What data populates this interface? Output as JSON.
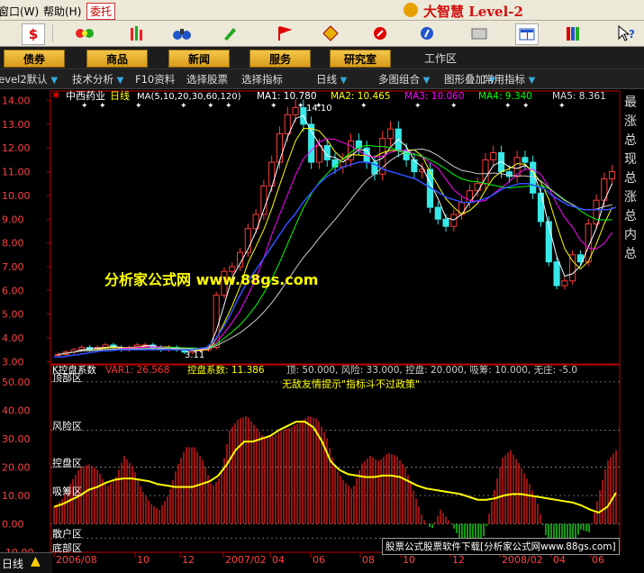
{
  "menu": {
    "window_label": "窗口(W)",
    "help_label": "帮助(H)",
    "order_label": "委托",
    "brand": "大智慧 Level-2"
  },
  "toolbar": {
    "icons": [
      "dollar-icon",
      "eye-icon",
      "bars-icon",
      "binoculars-icon",
      "flag-icon",
      "diamond-icon",
      "crystal-icon",
      "doc-icon",
      "grid-icon",
      "books-icon",
      "help-cursor-icon"
    ]
  },
  "nav": {
    "items": [
      "债券",
      "商品",
      "新闻",
      "服务",
      "研究室"
    ],
    "workspace": "工作区"
  },
  "subbar": {
    "items": [
      "Level2默认",
      "技术分析",
      "F10资料",
      "选择股票",
      "选择指标",
      "日线",
      "多图组合",
      "图形叠加",
      "常用指标"
    ]
  },
  "price_panel": {
    "stock_name": "中西药业",
    "period": "日线",
    "ma_label": "MA(5,10,20,30,60,120)",
    "ma_values": [
      {
        "label": "MA1:",
        "value": "10.780",
        "color": "#ffffff"
      },
      {
        "label": "MA2:",
        "value": "10.465",
        "color": "#ffff00"
      },
      {
        "label": "MA3:",
        "value": "10.060",
        "color": "#ff00ff"
      },
      {
        "label": "MA4:",
        "value": "9.340",
        "color": "#00ff00"
      },
      {
        "label": "MA5:",
        "value": "8.361",
        "color": "#dddddd"
      }
    ],
    "y_ticks": [
      "14.00",
      "13.00",
      "12.00",
      "11.00",
      "10.00",
      "9.00",
      "8.00",
      "7.00",
      "6.00",
      "5.00",
      "4.00",
      "3.00"
    ],
    "high_label": "14.10",
    "low_label": "3.11"
  },
  "indicator_panel": {
    "name": "K控盘系数",
    "var1": "VAR1: 26.568",
    "kong": "控盘系数: 11.386",
    "params": "顶: 50.000, 风险: 33.000, 控盘: 20.000, 吸筹: 10.000, 无庄: -5.0",
    "tip": "无敌友情提示\"指标斗不过政策\"",
    "y_ticks": [
      "50.00",
      "40.00",
      "30.00",
      "20.00",
      "10.00",
      "0.00",
      "-10.00"
    ],
    "zone_labels": [
      "顶部区",
      "风险区",
      "控盘区",
      "吸筹区",
      "散户区",
      "底部区"
    ]
  },
  "x_axis": {
    "ticks": [
      "2006/08",
      "10",
      "12",
      "2007/02",
      "04",
      "06",
      "08",
      "10",
      "12",
      "2008/02",
      "04",
      "06"
    ]
  },
  "right_labels": [
    "最",
    "涨",
    "总",
    "现",
    "总",
    "涨",
    "总",
    "内",
    "总"
  ],
  "watermark": "分析家公式网 www.88gs.com",
  "download_text": "股票公式股票软件下载[分析家公式网www.88gs.com]",
  "status": {
    "period": "日线"
  },
  "chart_data": {
    "type": "candlestick",
    "price": {
      "ylim": [
        2.9,
        14.4
      ],
      "close": [
        3.3,
        3.4,
        3.5,
        3.6,
        3.5,
        3.6,
        3.7,
        3.6,
        3.5,
        3.6,
        3.7,
        3.7,
        3.6,
        3.5,
        3.6,
        3.5,
        3.4,
        3.5,
        3.5,
        3.6,
        5.8,
        6.8,
        7.0,
        7.6,
        8.6,
        9.2,
        10.4,
        11.4,
        12.6,
        13.4,
        13.7,
        13.0,
        11.4,
        12.1,
        11.5,
        11.2,
        11.5,
        12.3,
        12.0,
        11.4,
        10.9,
        12.4,
        12.8,
        11.9,
        11.5,
        11.0,
        11.1,
        9.5,
        9.0,
        8.7,
        9.2,
        9.7,
        10.2,
        10.5,
        11.5,
        11.8,
        11.0,
        10.8,
        11.6,
        11.4,
        10.1,
        8.9,
        7.2,
        6.2,
        6.4,
        7.5,
        7.2,
        8.8,
        9.8,
        10.7,
        11.0
      ],
      "ma_long": [
        3.2,
        3.2,
        3.25,
        3.3,
        3.35,
        3.4,
        3.45,
        3.45,
        3.5,
        3.5,
        3.5,
        3.5,
        3.5,
        3.5,
        3.5,
        3.5,
        3.5,
        3.5,
        3.55,
        3.6,
        3.9,
        4.4,
        5.0,
        5.7,
        6.3,
        6.8,
        7.3,
        7.8,
        8.3,
        8.8,
        9.2,
        9.7,
        10.1,
        10.5,
        10.8,
        11.0,
        11.2,
        11.3,
        11.4,
        11.4,
        11.3,
        11.1,
        11.0,
        10.9,
        10.8,
        10.7,
        10.5,
        10.3,
        10.1,
        9.9,
        9.8,
        9.7,
        9.7,
        9.8,
        9.9,
        10.1,
        10.3,
        10.4,
        10.5,
        10.5,
        10.4,
        10.3,
        10.0,
        9.8,
        9.6,
        9.5,
        9.4,
        9.4,
        9.4,
        9.4,
        9.5
      ]
    },
    "indicator": {
      "ylim": [
        -10,
        56
      ],
      "var1": [
        6,
        9,
        15,
        20,
        21,
        19,
        13,
        16,
        24,
        20,
        12,
        7,
        5,
        10,
        20,
        27,
        27,
        22,
        13,
        17,
        33,
        37,
        38,
        34,
        30,
        31,
        33,
        34,
        36,
        38,
        37,
        31,
        20,
        15,
        12,
        21,
        24,
        22,
        25,
        24,
        20,
        11,
        2,
        -2,
        5,
        1,
        -4,
        -10,
        -9,
        -4,
        10,
        23,
        26,
        21,
        15,
        8,
        -4,
        -8,
        -11,
        -8,
        -2,
        -3,
        10,
        22,
        26
      ],
      "kong": [
        6,
        7,
        8.5,
        10,
        12,
        13,
        14.5,
        15.5,
        16,
        16,
        15.5,
        15,
        14,
        13.5,
        13,
        13,
        13,
        14,
        15,
        17,
        21,
        26,
        29,
        29,
        30,
        31,
        33,
        34.5,
        36,
        36,
        34,
        29,
        22,
        19,
        17.5,
        17,
        16.5,
        16.5,
        17,
        17,
        16.5,
        15,
        13.5,
        12.5,
        12,
        11.5,
        11,
        10.5,
        9.5,
        8.5,
        8.5,
        9,
        10,
        10.5,
        10.5,
        10,
        9.5,
        9,
        8.5,
        8,
        7.5,
        6.5,
        5,
        4,
        6,
        11
      ]
    }
  }
}
